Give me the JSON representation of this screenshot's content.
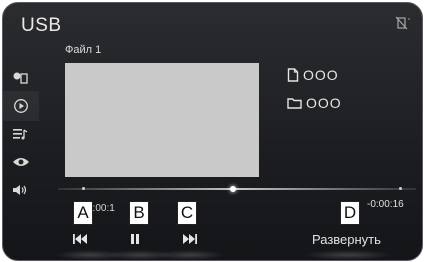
{
  "header": {
    "title": "USB",
    "signal_icon": "no-signal-icon"
  },
  "sidebar": {
    "items": [
      {
        "name": "source-icon"
      },
      {
        "name": "play-icon",
        "active": true
      },
      {
        "name": "playlist-icon"
      },
      {
        "name": "eye-icon"
      },
      {
        "name": "volume-icon"
      }
    ]
  },
  "track": {
    "file_label": "Файл 1",
    "artwork_color": "#c9c9c9",
    "file_name": "OOO",
    "folder_name": "OOO"
  },
  "playback": {
    "elapsed": "0:00:1",
    "remaining": "-0:00:16",
    "progress": 0.49
  },
  "controls": {
    "prev_icon": "skip-back-icon",
    "pause_icon": "pause-icon",
    "next_icon": "skip-forward-icon",
    "expand_label": "Развернуть"
  },
  "callouts": {
    "a": "A",
    "b": "B",
    "c": "C",
    "d": "D"
  }
}
